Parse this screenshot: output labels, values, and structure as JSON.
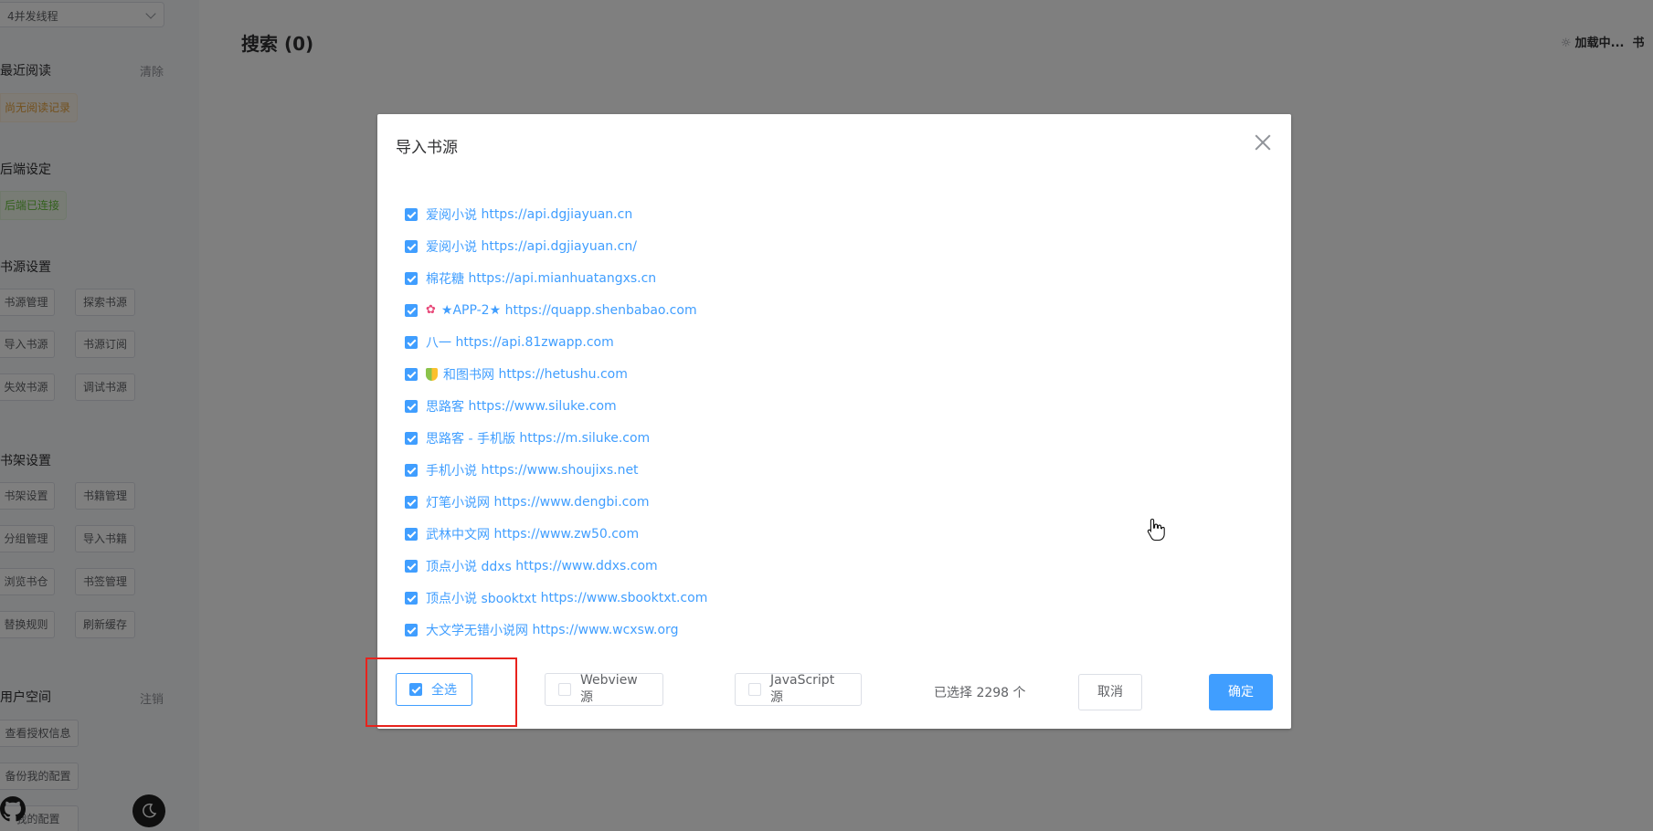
{
  "sidebar": {
    "thread_select": "4并发线程",
    "recent": {
      "title": "最近阅读",
      "action": "清除",
      "empty_tag": "尚无阅读记录"
    },
    "backend": {
      "title": "后端设定",
      "status_tag": "后端已连接"
    },
    "source_settings": {
      "title": "书源设置",
      "buttons": [
        "书源管理",
        "探索书源",
        "导入书源",
        "书源订阅",
        "失效书源",
        "调试书源"
      ]
    },
    "shelf_settings": {
      "title": "书架设置",
      "buttons": [
        "书架设置",
        "书籍管理",
        "分组管理",
        "导入书籍",
        "浏览书仓",
        "书签管理",
        "替换规则",
        "刷新缓存"
      ]
    },
    "user_space": {
      "title": "用户空间",
      "action": "注销",
      "buttons": [
        "查看授权信息",
        "备份我的配置",
        "我的配置"
      ]
    }
  },
  "main": {
    "title": "搜索 (0)",
    "loading": "加载中...",
    "loading_suffix": "书"
  },
  "dialog": {
    "title": "导入书源",
    "sources": [
      {
        "name": "爱阅小说",
        "url": "https://api.dgjiayuan.cn",
        "icon": ""
      },
      {
        "name": "爱阅小说",
        "url": "https://api.dgjiayuan.cn/",
        "icon": ""
      },
      {
        "name": "棉花糖",
        "url": "https://api.mianhuatangxs.cn",
        "icon": ""
      },
      {
        "name": "★APP-2★",
        "url": "https://quapp.shenbabao.com",
        "icon": "flower-icon"
      },
      {
        "name": "八一",
        "url": "https://api.81zwapp.com",
        "icon": ""
      },
      {
        "name": "和图书网",
        "url": "https://hetushu.com",
        "icon": "shield-icon"
      },
      {
        "name": "思路客",
        "url": "https://www.siluke.com",
        "icon": ""
      },
      {
        "name": "思路客 - 手机版",
        "url": "https://m.siluke.com",
        "icon": ""
      },
      {
        "name": "手机小说",
        "url": "https://www.shoujixs.net",
        "icon": ""
      },
      {
        "name": "灯笔小说网",
        "url": "https://www.dengbi.com",
        "icon": ""
      },
      {
        "name": "武林中文网",
        "url": "https://www.zw50.com",
        "icon": ""
      },
      {
        "name": "顶点小说 ddxs",
        "url": "https://www.ddxs.com",
        "icon": ""
      },
      {
        "name": "顶点小说 sbooktxt",
        "url": "https://www.sbooktxt.com",
        "icon": ""
      },
      {
        "name": "大文学无错小说网",
        "url": "https://www.wcxsw.org",
        "icon": ""
      }
    ],
    "check_all": {
      "label": "全选",
      "checked": true
    },
    "webview": {
      "label": "Webview 源",
      "checked": false
    },
    "javascript": {
      "label": "JavaScript 源",
      "checked": false
    },
    "selected_count": "已选择 2298 个",
    "cancel": "取消",
    "confirm": "确定"
  },
  "colors": {
    "accent": "#409eff",
    "highlight": "#e8231d",
    "overlay": "rgba(0,0,0,0.5)"
  }
}
